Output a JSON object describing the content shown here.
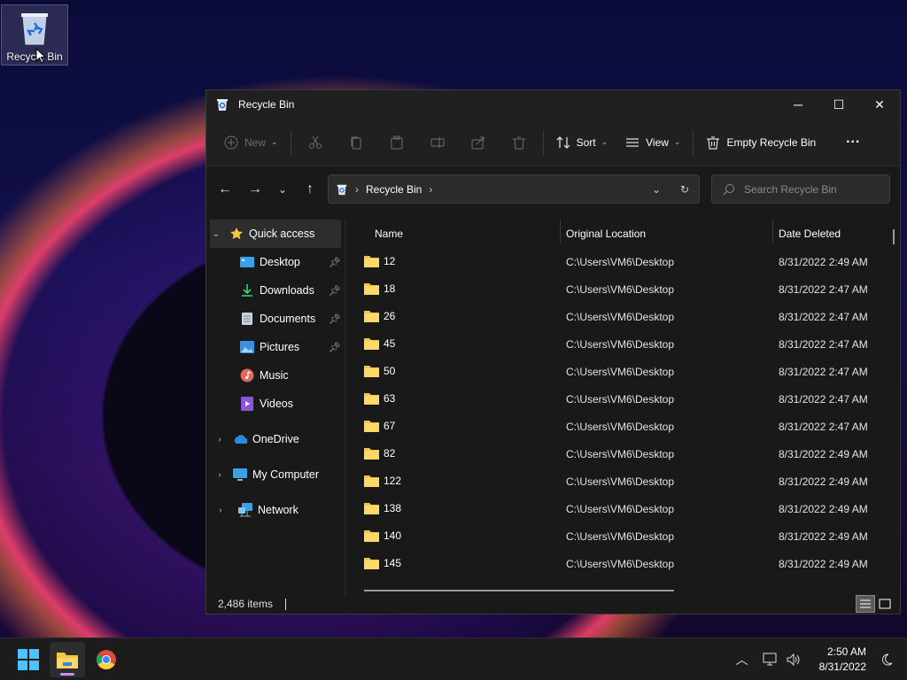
{
  "desktop": {
    "recycle_bin_label": "Recycle Bin"
  },
  "window": {
    "title": "Recycle Bin",
    "controls": {
      "minimize": "─",
      "maximize": "☐",
      "close": "✕"
    }
  },
  "toolbar": {
    "new_label": "New",
    "sort_label": "Sort",
    "view_label": "View",
    "empty_label": "Empty Recycle Bin",
    "more_label": "···"
  },
  "address": {
    "crumb": "Recycle Bin",
    "search_placeholder": "Search Recycle Bin"
  },
  "nav": {
    "quick_access": "Quick access",
    "items": [
      {
        "label": "Desktop",
        "pinned": true
      },
      {
        "label": "Downloads",
        "pinned": true
      },
      {
        "label": "Documents",
        "pinned": true
      },
      {
        "label": "Pictures",
        "pinned": true
      },
      {
        "label": "Music",
        "pinned": false
      },
      {
        "label": "Videos",
        "pinned": false
      }
    ],
    "onedrive": "OneDrive",
    "my_computer": "My Computer",
    "network": "Network"
  },
  "columns": {
    "name": "Name",
    "location": "Original Location",
    "date": "Date Deleted"
  },
  "rows": [
    {
      "name": "12",
      "location": "C:\\Users\\VM6\\Desktop",
      "date": "8/31/2022 2:49 AM"
    },
    {
      "name": "18",
      "location": "C:\\Users\\VM6\\Desktop",
      "date": "8/31/2022 2:47 AM"
    },
    {
      "name": "26",
      "location": "C:\\Users\\VM6\\Desktop",
      "date": "8/31/2022 2:47 AM"
    },
    {
      "name": "45",
      "location": "C:\\Users\\VM6\\Desktop",
      "date": "8/31/2022 2:47 AM"
    },
    {
      "name": "50",
      "location": "C:\\Users\\VM6\\Desktop",
      "date": "8/31/2022 2:47 AM"
    },
    {
      "name": "63",
      "location": "C:\\Users\\VM6\\Desktop",
      "date": "8/31/2022 2:47 AM"
    },
    {
      "name": "67",
      "location": "C:\\Users\\VM6\\Desktop",
      "date": "8/31/2022 2:47 AM"
    },
    {
      "name": "82",
      "location": "C:\\Users\\VM6\\Desktop",
      "date": "8/31/2022 2:49 AM"
    },
    {
      "name": "122",
      "location": "C:\\Users\\VM6\\Desktop",
      "date": "8/31/2022 2:49 AM"
    },
    {
      "name": "138",
      "location": "C:\\Users\\VM6\\Desktop",
      "date": "8/31/2022 2:49 AM"
    },
    {
      "name": "140",
      "location": "C:\\Users\\VM6\\Desktop",
      "date": "8/31/2022 2:49 AM"
    },
    {
      "name": "145",
      "location": "C:\\Users\\VM6\\Desktop",
      "date": "8/31/2022 2:49 AM"
    }
  ],
  "status": {
    "item_count": "2,486 items"
  },
  "taskbar": {
    "time": "2:50 AM",
    "date": "8/31/2022"
  },
  "colors": {
    "folder": "#f5c542",
    "accent": "#4cc2ff",
    "window_bg": "#191919"
  }
}
